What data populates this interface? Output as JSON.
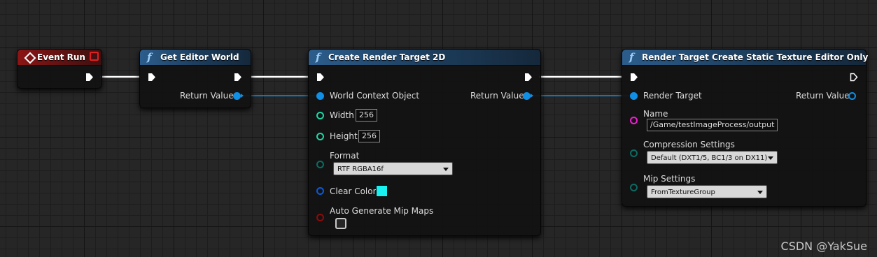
{
  "nodes": {
    "event_run": {
      "title": "Event Run"
    },
    "get_editor_world": {
      "title": "Get Editor World",
      "return_label": "Return Value"
    },
    "create_render_target": {
      "title": "Create Render Target 2D",
      "world_context_label": "World Context Object",
      "return_label": "Return Value",
      "width_label": "Width",
      "width_value": "256",
      "height_label": "Height",
      "height_value": "256",
      "format_label": "Format",
      "format_value": "RTF RGBA16f",
      "clear_color_label": "Clear Color",
      "clear_color": "#19f0f0",
      "auto_mip_label": "Auto Generate Mip Maps",
      "auto_mip_checked": false
    },
    "render_target_static_texture": {
      "title": "Render Target Create Static Texture Editor Only",
      "render_target_label": "Render Target",
      "return_label": "Return Value",
      "name_label": "Name",
      "name_value": "/Game/testImageProcess/output",
      "compression_label": "Compression Settings",
      "compression_value": "Default (DXT1/5, BC1/3 on DX11)",
      "mip_label": "Mip Settings",
      "mip_value": "FromTextureGroup"
    }
  },
  "watermark": "CSDN @YakSue",
  "colors": {
    "exec_wire": "#ffffff",
    "object_pin": "#0f8fe6",
    "int_pin": "#1ed6a4",
    "string_pin": "#f01ed2",
    "enum_pin": "#0b6b62",
    "struct_pin": "#0b5ad6",
    "bool_pin": "#8c0b0b",
    "event_header": "#8c1515",
    "function_header": "#2c5d8c"
  }
}
